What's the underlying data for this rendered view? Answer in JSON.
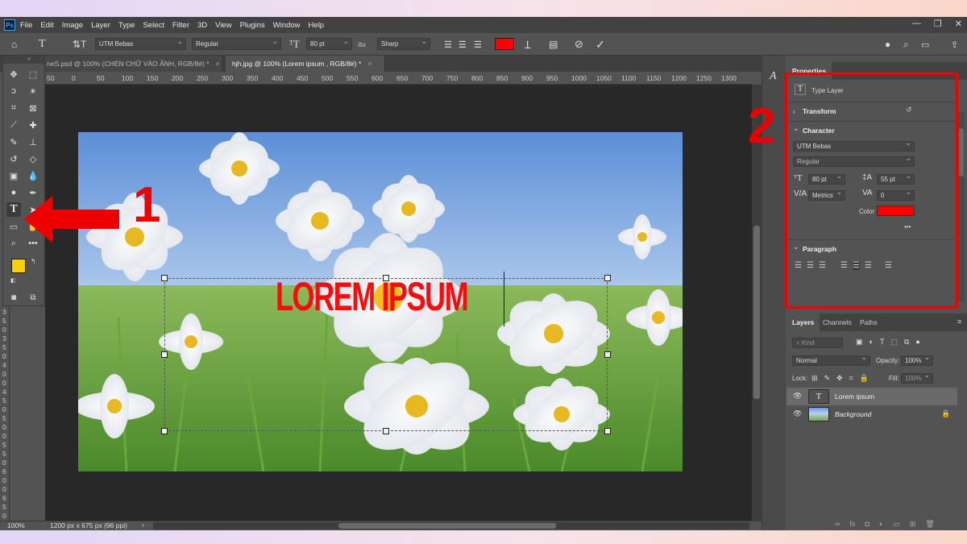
{
  "menu": {
    "logo": "Ps",
    "items": [
      "File",
      "Edit",
      "Image",
      "Layer",
      "Type",
      "Select",
      "Filter",
      "3D",
      "View",
      "Plugins",
      "Window",
      "Help"
    ]
  },
  "window_controls": {
    "minimize": "—",
    "restore": "❐",
    "close": "✕"
  },
  "options_bar": {
    "font_family": "UTM Bebas",
    "font_style": "Regular",
    "font_size": "80 pt",
    "antialias_label": "a",
    "antialias": "Sharp",
    "text_color": "#ff0000"
  },
  "tabs": [
    {
      "label": "neS.psd @ 100% (CHÈN CHỮ VÀO ẢNH, RGB/8#) *",
      "close": "×"
    },
    {
      "label": "hjh.jpg @ 100% (Lorem ipsum , RGB/8#) *",
      "close": "×"
    }
  ],
  "ruler": {
    "h": [
      "50",
      "0",
      "50",
      "100",
      "150",
      "200",
      "250",
      "300",
      "350",
      "400",
      "450",
      "500",
      "550",
      "600",
      "650",
      "700",
      "750",
      "800",
      "850",
      "900",
      "950",
      "1000",
      "1050",
      "1100",
      "1150",
      "1200",
      "1250",
      "1300"
    ],
    "v": [
      "3",
      "5",
      "0",
      "3",
      "5",
      "0",
      "4",
      "0",
      "0",
      "4",
      "5",
      "0",
      "5",
      "0",
      "0",
      "5",
      "5",
      "0",
      "6",
      "0",
      "0",
      "6",
      "5",
      "0"
    ]
  },
  "canvas": {
    "text": "LOREM IPSUM",
    "text_color": "#ff0a0a"
  },
  "status": {
    "zoom": "100%",
    "size": "1200 px x 675 px (96 ppi)",
    "arrow": "›"
  },
  "properties": {
    "tab": "Properties",
    "type_layer": "Type Layer",
    "transform": "Transform",
    "character": "Character",
    "font_family": "UTM Bebas",
    "font_style": "Regular",
    "size": "80 pt",
    "leading": "55 pt",
    "kerning": "Metrics",
    "tracking": "0",
    "color_label": "Color",
    "color": "#ff0000",
    "more": "•••",
    "paragraph": "Paragraph"
  },
  "layers_panel": {
    "tabs": [
      "Layers",
      "Channels",
      "Paths"
    ],
    "kind_placeholder": "Kind",
    "blend_mode": "Normal",
    "opacity_label": "Opacity:",
    "opacity": "100%",
    "lock_label": "Lock:",
    "fill_label": "Fill:",
    "fill": "100%",
    "layers": [
      {
        "name": "Lorem ipsum",
        "type": "text"
      },
      {
        "name": "Background",
        "type": "image"
      }
    ]
  },
  "annotations": {
    "one": "1",
    "two": "2",
    "color": "#ee0000"
  }
}
